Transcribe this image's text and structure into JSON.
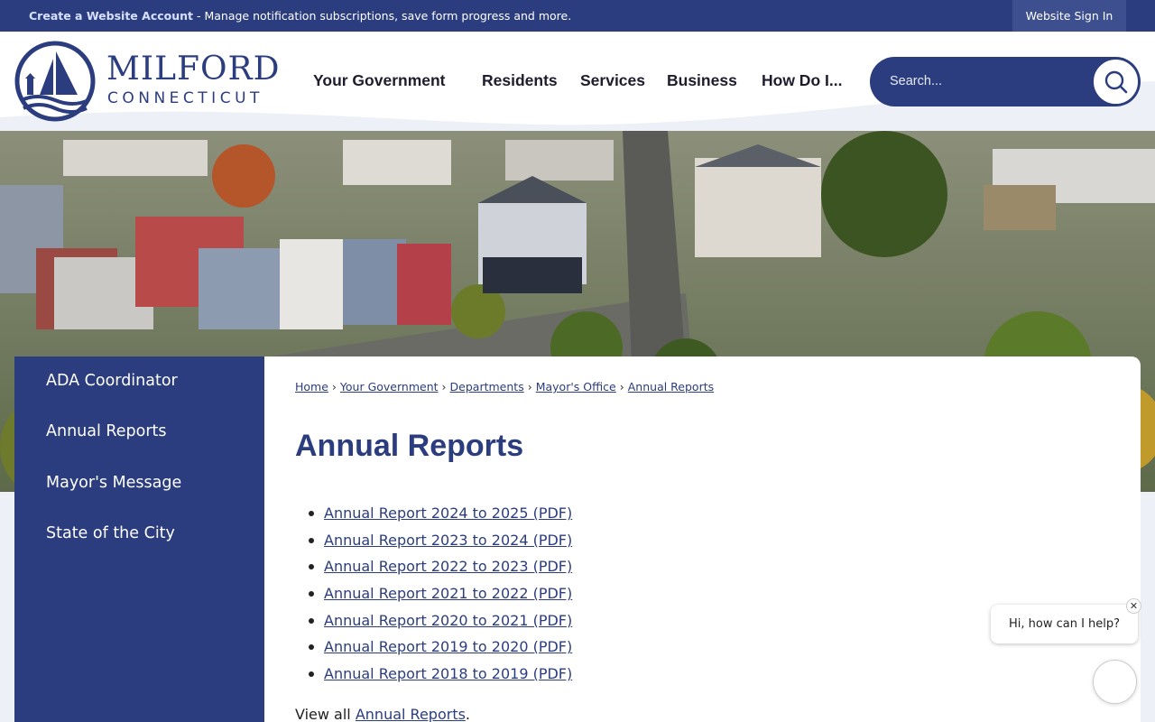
{
  "topbar": {
    "account_link": "Create a Website Account",
    "account_desc": " - Manage notification subscriptions, save form progress and more.",
    "signin": "Website Sign In"
  },
  "logo": {
    "name": "MILFORD",
    "state": "CONNECTICUT"
  },
  "nav": {
    "items": [
      "Your Government",
      "Residents",
      "Services",
      "Business",
      "How Do I..."
    ]
  },
  "search": {
    "placeholder": "Search..."
  },
  "sidebar": {
    "items": [
      "ADA Coordinator",
      "Annual Reports",
      "Mayor's Message",
      "State of the City"
    ]
  },
  "breadcrumb": {
    "items": [
      "Home",
      "Your Government",
      "Departments",
      "Mayor's Office",
      "Annual Reports"
    ],
    "separator": "›"
  },
  "page": {
    "title": "Annual Reports",
    "reports": [
      "Annual Report 2024 to 2025 (PDF)",
      "Annual Report 2023 to 2024 (PDF)",
      "Annual Report 2022 to 2023 (PDF)",
      "Annual Report 2021 to 2022 (PDF)",
      "Annual Report 2020 to 2021 (PDF)",
      "Annual Report 2019 to 2020 (PDF)",
      "Annual Report 2018 to 2019 (PDF)"
    ],
    "view_all_prefix": "View all ",
    "view_all_link": "Annual Reports",
    "view_all_suffix": "."
  },
  "chat": {
    "greeting": "Hi, how can I help?",
    "close": "✕"
  },
  "colors": {
    "brand": "#2b3d7e",
    "background": "#eef0f7"
  }
}
